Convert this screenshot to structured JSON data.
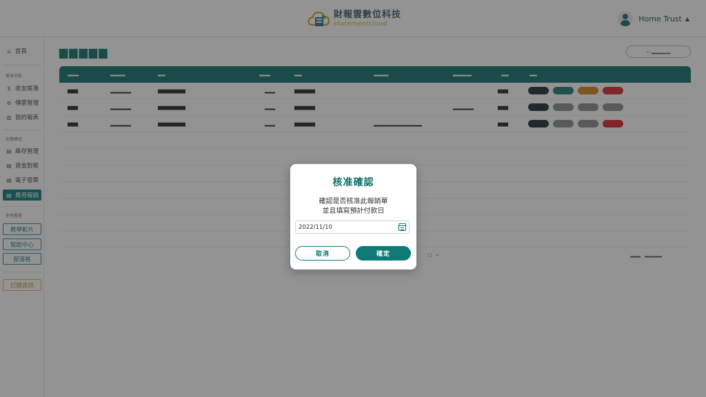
{
  "header": {
    "logo_cn": "財報雲數位科技",
    "logo_en": "statementcloud",
    "user_name": "Home Trust",
    "user_caret": "▲"
  },
  "sidebar": {
    "home": {
      "label": "首頁",
      "icon": "home-icon"
    },
    "section_basic": "基本功能",
    "items_basic": [
      {
        "label": "收支帳簿",
        "icon": "money-icon"
      },
      {
        "label": "傳票管理",
        "icon": "voucher-icon"
      },
      {
        "label": "我的報表",
        "icon": "chart-icon"
      }
    ],
    "section_addon": "加購模組",
    "items_addon": [
      {
        "label": "庫存管理",
        "icon": "document-icon"
      },
      {
        "label": "資金對帳",
        "icon": "document-icon"
      },
      {
        "label": "電子發票",
        "icon": "document-icon"
      },
      {
        "label": "費用報銷",
        "icon": "document-icon",
        "active": true
      }
    ],
    "section_teach": "參考教學",
    "buttons_teach": [
      "教學影片",
      "幫助中心",
      "部落格"
    ],
    "subscribe": "訂閱資訊"
  },
  "modal": {
    "title": "核准確認",
    "line1": "確認是否核准此報銷單",
    "line2": "並且填寫預計付款日",
    "date_value": "2022/11/10",
    "cancel_label": "取消",
    "confirm_label": "確定"
  },
  "colors": {
    "primary": "#0d7a75",
    "accent_gold": "#c9a227",
    "overlay": "rgba(40,40,40,0.5)"
  }
}
